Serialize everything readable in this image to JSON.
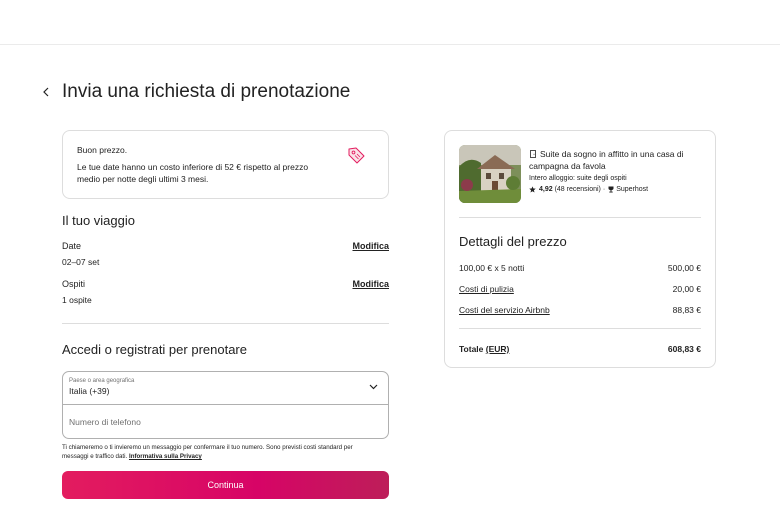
{
  "page": {
    "title": "Invia una richiesta di prenotazione"
  },
  "colors": {
    "accent_start": "#e31c5f",
    "accent_end": "#bd1e59",
    "text": "#222222",
    "muted": "#717171",
    "border": "#dddddd"
  },
  "price_notice": {
    "title": "Buon prezzo.",
    "text": "Le tue date hanno un costo inferiore di 52 € rispetto al prezzo medio per notte degli ultimi 3 mesi.",
    "icon": "price-tag-icon"
  },
  "trip": {
    "title": "Il tuo viaggio",
    "dates": {
      "label": "Date",
      "value": "02–07 set",
      "edit": "Modifica"
    },
    "guests": {
      "label": "Ospiti",
      "value": "1 ospite",
      "edit": "Modifica"
    }
  },
  "login": {
    "title": "Accedi o registrati per prenotare",
    "country": {
      "label": "Paese o area geografica",
      "value": "Italia (+39)"
    },
    "phone": {
      "placeholder": "Numero di telefono",
      "value": ""
    },
    "disclaimer": "Ti chiameremo o ti invieremo un messaggio per confermare il tuo numero. Sono previsti costi standard per messaggi e traffico dati.",
    "privacy_link": "Informativa sulla Privacy",
    "continue": "Continua"
  },
  "listing": {
    "title": "Suite da sogno in affitto in una casa di campagna da favola",
    "subtitle": "Intero alloggio: suite degli ospiti",
    "rating": "4,92",
    "reviews": "(48 recensioni)",
    "separator": "·",
    "badge": "Superhost"
  },
  "price_details": {
    "title": "Dettagli del prezzo",
    "rows": [
      {
        "label": "100,00 € x 5 notti",
        "value": "500,00 €"
      },
      {
        "label": "Costi di pulizia",
        "value": "20,00 €"
      },
      {
        "label": "Costi del servizio Airbnb",
        "value": "88,83 €"
      }
    ],
    "total": {
      "label": "Totale",
      "currency": "(EUR)",
      "value": "608,83 €"
    }
  }
}
